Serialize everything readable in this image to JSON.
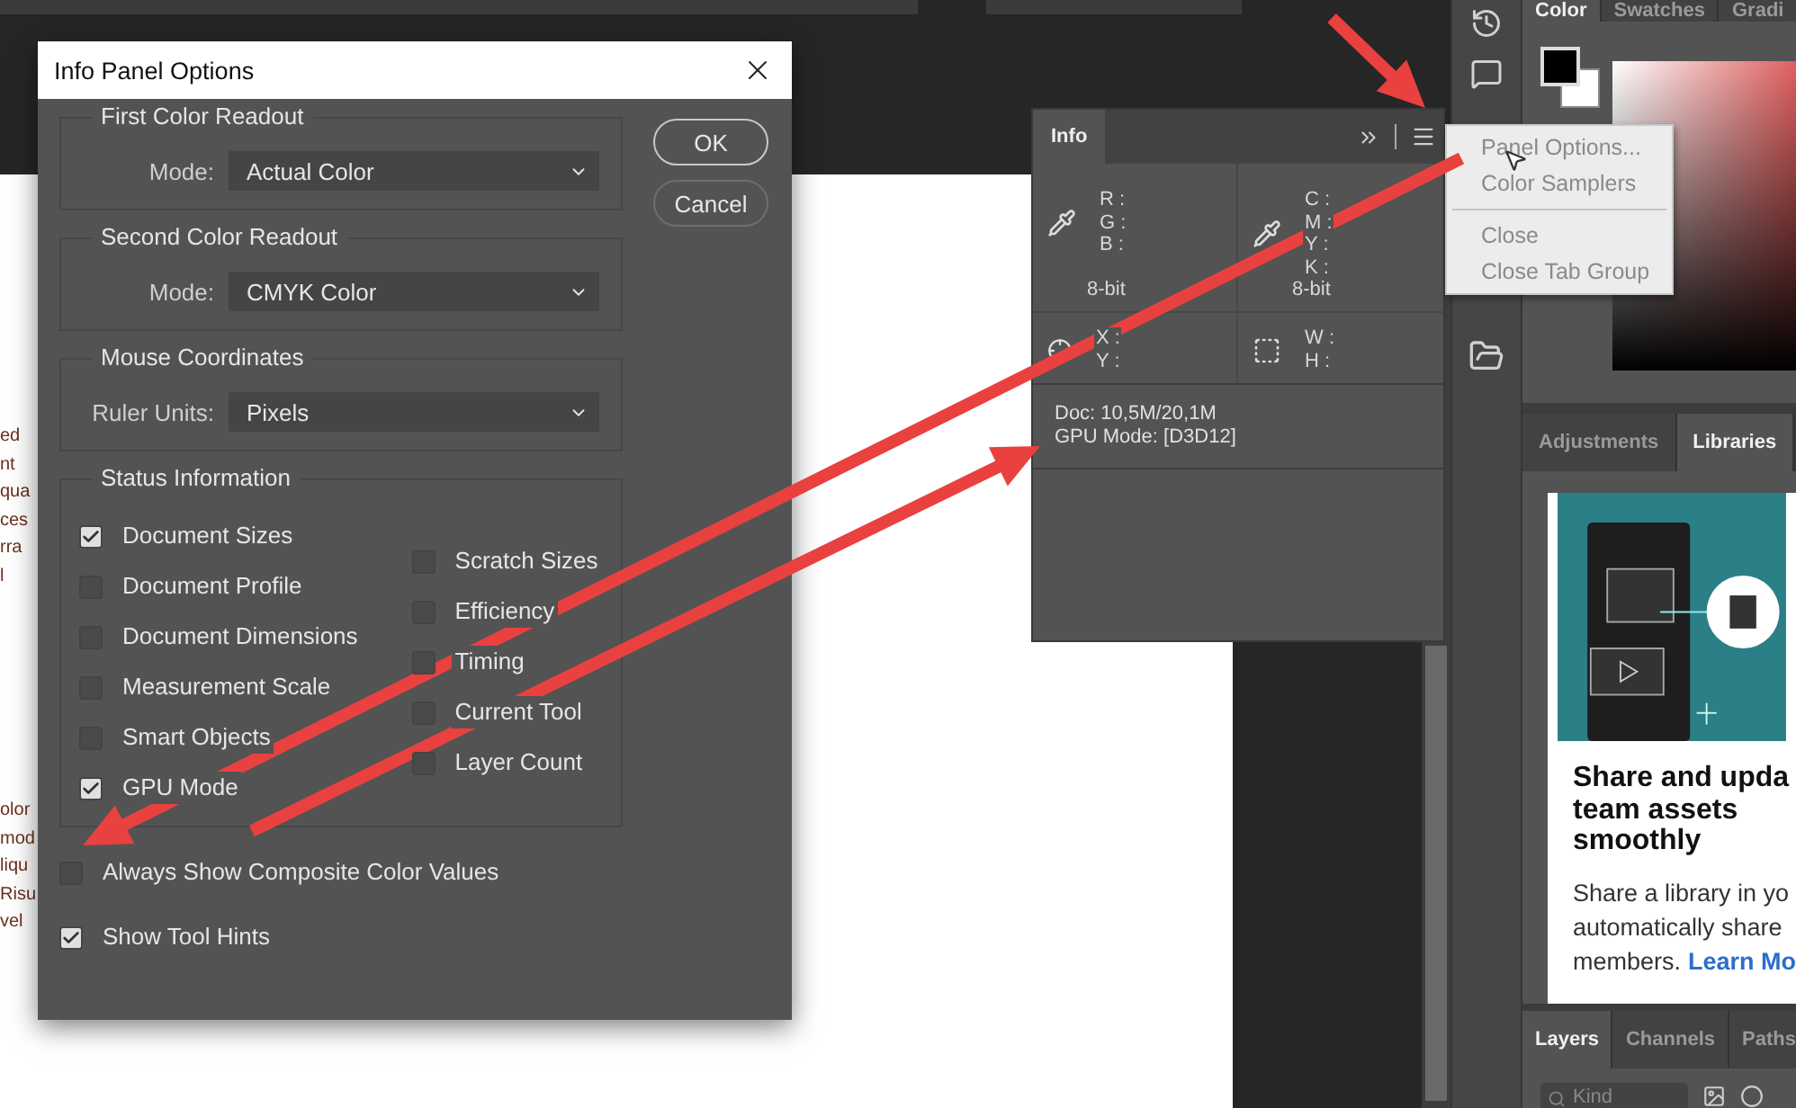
{
  "document": {
    "text_fragments": [
      [
        "ed",
        "nt",
        "qua",
        "ces",
        "rra",
        "l"
      ],
      [
        "olor",
        "mod",
        "liqu",
        "Risu",
        "vel"
      ]
    ]
  },
  "dialog": {
    "title": "Info Panel Options",
    "groups": [
      {
        "title": "First Color Readout",
        "label": "Mode:",
        "value": "Actual Color"
      },
      {
        "title": "Second Color Readout",
        "label": "Mode:",
        "value": "CMYK Color"
      },
      {
        "title": "Mouse Coordinates",
        "label": "Ruler Units:",
        "value": "Pixels"
      }
    ],
    "status": {
      "title": "Status Information",
      "columns": [
        [
          {
            "label": "Document Sizes",
            "checked": true
          },
          {
            "label": "Document Profile",
            "checked": false
          },
          {
            "label": "Document Dimensions",
            "checked": false
          },
          {
            "label": "Measurement Scale",
            "checked": false
          },
          {
            "label": "Smart Objects",
            "checked": false
          },
          {
            "label": "GPU Mode",
            "checked": true
          }
        ],
        [
          {
            "label": "Scratch Sizes",
            "checked": false
          },
          {
            "label": "Efficiency",
            "checked": false
          },
          {
            "label": "Timing",
            "checked": false
          },
          {
            "label": "Current Tool",
            "checked": false
          },
          {
            "label": "Layer Count",
            "checked": false
          }
        ]
      ]
    },
    "options": [
      {
        "label": "Always Show Composite Color Values",
        "checked": false
      },
      {
        "label": "Show Tool Hints",
        "checked": true
      }
    ],
    "buttons": [
      "OK",
      "Cancel"
    ]
  },
  "info_panel": {
    "tab": "Info",
    "cells": [
      {
        "kind": "eyedropper",
        "labels": [
          "R :",
          "G :",
          "B :"
        ],
        "depth": "8-bit"
      },
      {
        "kind": "eyedropper",
        "labels": [
          "C :",
          "M :",
          "Y :",
          "K :"
        ],
        "depth": "8-bit"
      },
      {
        "kind": "crosshair",
        "labels": [
          "X :",
          "Y :"
        ]
      },
      {
        "kind": "size",
        "labels": [
          "W :",
          "H :"
        ]
      }
    ],
    "status_lines": [
      "Doc: 10,5M/20,1M",
      "GPU Mode: [D3D12]"
    ]
  },
  "panel_menu": {
    "groups": [
      [
        "Panel Options...",
        "Color Samplers"
      ],
      [
        "Close",
        "Close Tab Group"
      ]
    ]
  },
  "color_panel": {
    "tabs": [
      {
        "label": "Color",
        "selected": true
      },
      {
        "label": "Swatches",
        "selected": false
      },
      {
        "label": "Gradi",
        "selected": false
      }
    ]
  },
  "libraries_panel": {
    "tabs": [
      {
        "label": "Adjustments",
        "selected": false
      },
      {
        "label": "Libraries",
        "selected": true
      }
    ],
    "heading": "Share and upda team assets smoothly",
    "body_lines": [
      "Share a library in yo",
      "automatically share"
    ],
    "cut_line": "members.",
    "link": "Learn Mo"
  },
  "layers_panel": {
    "tabs": [
      {
        "label": "Layers",
        "selected": true
      },
      {
        "label": "Channels",
        "selected": false
      },
      {
        "label": "Paths",
        "selected": false
      }
    ],
    "search": {
      "placeholder": "Kind"
    }
  }
}
